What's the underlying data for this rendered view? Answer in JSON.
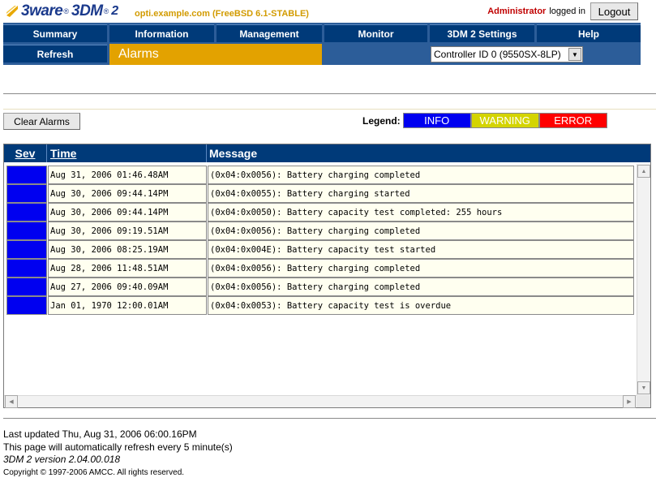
{
  "header": {
    "logo_brand": "3ware",
    "logo_reg": "®",
    "logo_product": "3DM",
    "logo_sup": "®",
    "logo_version": "2",
    "host_info": "opti.example.com (FreeBSD 6.1-STABLE)",
    "username": "Administrator",
    "logged_in_text": "logged in",
    "logout_label": "Logout"
  },
  "nav": {
    "items": [
      "Summary",
      "Information",
      "Management",
      "Monitor",
      "3DM 2 Settings",
      "Help"
    ],
    "refresh_label": "Refresh",
    "current_page": "Alarms",
    "controller_select_value": "Controller ID 0 (9550SX-8LP)"
  },
  "toolbar": {
    "clear_alarms_label": "Clear Alarms",
    "legend_label": "Legend:",
    "legend": [
      {
        "label": "INFO",
        "color": "#0000f0",
        "text_color": "#ffffff"
      },
      {
        "label": "WARNING",
        "color": "#d4d400",
        "text_color": "#ffffff"
      },
      {
        "label": "ERROR",
        "color": "#ff0000",
        "text_color": "#ffffff"
      }
    ]
  },
  "table": {
    "headers": {
      "sev": "Sev",
      "time": "Time",
      "message": "Message"
    },
    "rows": [
      {
        "sev": "info",
        "time": "Aug 31, 2006 01:46.48AM",
        "message": "(0x04:0x0056): Battery charging completed"
      },
      {
        "sev": "info",
        "time": "Aug 30, 2006 09:44.14PM",
        "message": "(0x04:0x0055): Battery charging started"
      },
      {
        "sev": "info",
        "time": "Aug 30, 2006 09:44.14PM",
        "message": "(0x04:0x0050): Battery capacity test completed: 255 hours"
      },
      {
        "sev": "info",
        "time": "Aug 30, 2006 09:19.51AM",
        "message": "(0x04:0x0056): Battery charging completed"
      },
      {
        "sev": "info",
        "time": "Aug 30, 2006 08:25.19AM",
        "message": "(0x04:0x004E): Battery capacity test started"
      },
      {
        "sev": "info",
        "time": "Aug 28, 2006 11:48.51AM",
        "message": "(0x04:0x0056): Battery charging completed"
      },
      {
        "sev": "info",
        "time": "Aug 27, 2006 09:40.09AM",
        "message": "(0x04:0x0056): Battery charging completed"
      },
      {
        "sev": "info",
        "time": "Jan 01, 1970 12:00.01AM",
        "message": "(0x04:0x0053): Battery capacity test is overdue"
      }
    ]
  },
  "footer": {
    "last_updated": "Last updated Thu, Aug 31, 2006 06:00.16PM",
    "refresh_note": "This page will automatically refresh every 5 minute(s)",
    "version": "3DM 2 version 2.04.00.018",
    "copyright": "Copyright © 1997-2006 AMCC. All rights reserved."
  },
  "colors": {
    "nav_dark": "#003a79",
    "nav_bg": "#2c5d99",
    "accent_orange": "#e3a200",
    "info_blue": "#0000f0"
  }
}
